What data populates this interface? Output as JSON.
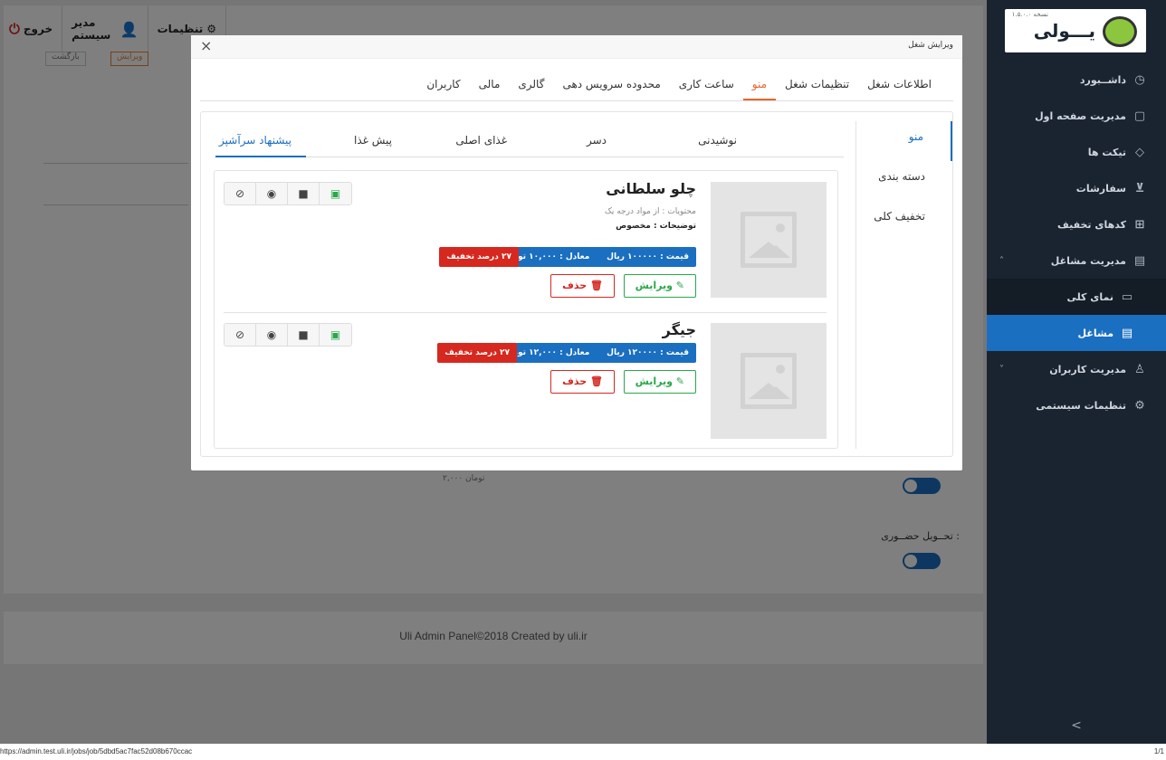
{
  "topbar": {
    "exit_label": "خروج",
    "exit_icon": "power-icon",
    "user_label": "مدیر سیستم",
    "user_icon": "user-icon",
    "settings_label": "تنظیمات",
    "settings_icon": "gears-icon"
  },
  "background": {
    "btn_edit": "ویرایش",
    "btn_back": "بازگشت",
    "price_text": "۲,۰۰۰ تومان",
    "delivery_label": "تحــویل حضــوری :"
  },
  "footer": {
    "text": "Uli Admin Panel©2018 Created by uli.ir"
  },
  "sidebar": {
    "logo": {
      "version": "نسخه ۱.۵.۰.۰",
      "name": "یـــولی"
    },
    "items": [
      {
        "label": "داشــبورد",
        "icon": "dashboard-icon"
      },
      {
        "label": "مدیریت صفحه اول",
        "icon": "page-icon"
      },
      {
        "label": "تیکت ها",
        "icon": "tag-icon"
      },
      {
        "label": "سفارشات",
        "icon": "cart-icon"
      },
      {
        "label": "کدهای تخفیف",
        "icon": "gift-icon"
      },
      {
        "label": "مدیریت مشاغل",
        "icon": "store-icon"
      },
      {
        "label": "نمای کلی",
        "icon": "monitor-icon"
      },
      {
        "label": "مشاغل",
        "icon": "store-icon"
      },
      {
        "label": "مدیریت کاربران",
        "icon": "users-icon"
      },
      {
        "label": "تنظیمات سیستمی",
        "icon": "gear-icon"
      }
    ],
    "bottom_arrow": ">"
  },
  "statusbar": {
    "url": "https://admin.test.uli.ir/jobs/job/5dbd5ac7fac52d08b670ccac",
    "page": "1/1"
  },
  "modal": {
    "title": "ویرایش شغل",
    "close": "×",
    "main_tabs": [
      "اطلاعات شغل",
      "تنظیمات شغل",
      "منو",
      "ساعت کاری",
      "محدوده سرویس دهی",
      "گالری",
      "مالی",
      "کاربران"
    ],
    "active_main_tab": "منو",
    "side_tabs": [
      "منو",
      "دسته بندی",
      "تخفیف کلی"
    ],
    "category_tabs": [
      "نوشیدنی",
      "دسر",
      "غذای اصلی",
      "پیش غذا",
      "پیشنهاد سرآشپز"
    ],
    "active_category": "پیشنهاد سرآشپز",
    "items": [
      {
        "name": "چلو سلطانی",
        "contents": "محتویات : از مواد درجه یک",
        "description": "توضیحات : مخصوص",
        "price": "قیمت : ۱۰۰۰۰۰ ریال",
        "equivalent": "معادل : ۱۰,۰۰۰ تومان",
        "discount": "۲۷ درصد تخفیف",
        "edit_label": "ویرایش",
        "delete_label": "حذف"
      },
      {
        "name": "جیگر",
        "contents": "",
        "description": "",
        "price": "قیمت : ۱۲۰۰۰۰ ریال",
        "equivalent": "معادل : ۱۲,۰۰۰ تومان",
        "discount": "۲۷ درصد تخفیف",
        "edit_label": "ویرایش",
        "delete_label": "حذف"
      }
    ],
    "item_icons": [
      "hidden-eye-icon",
      "eye-icon",
      "lock-icon",
      "unlock-icon"
    ]
  },
  "colors": {
    "accent_blue": "#1b6fc0",
    "accent_orange": "#e8652e",
    "danger": "#d6281f",
    "success": "#2aa84a",
    "sidebar_bg": "#1a2431"
  }
}
